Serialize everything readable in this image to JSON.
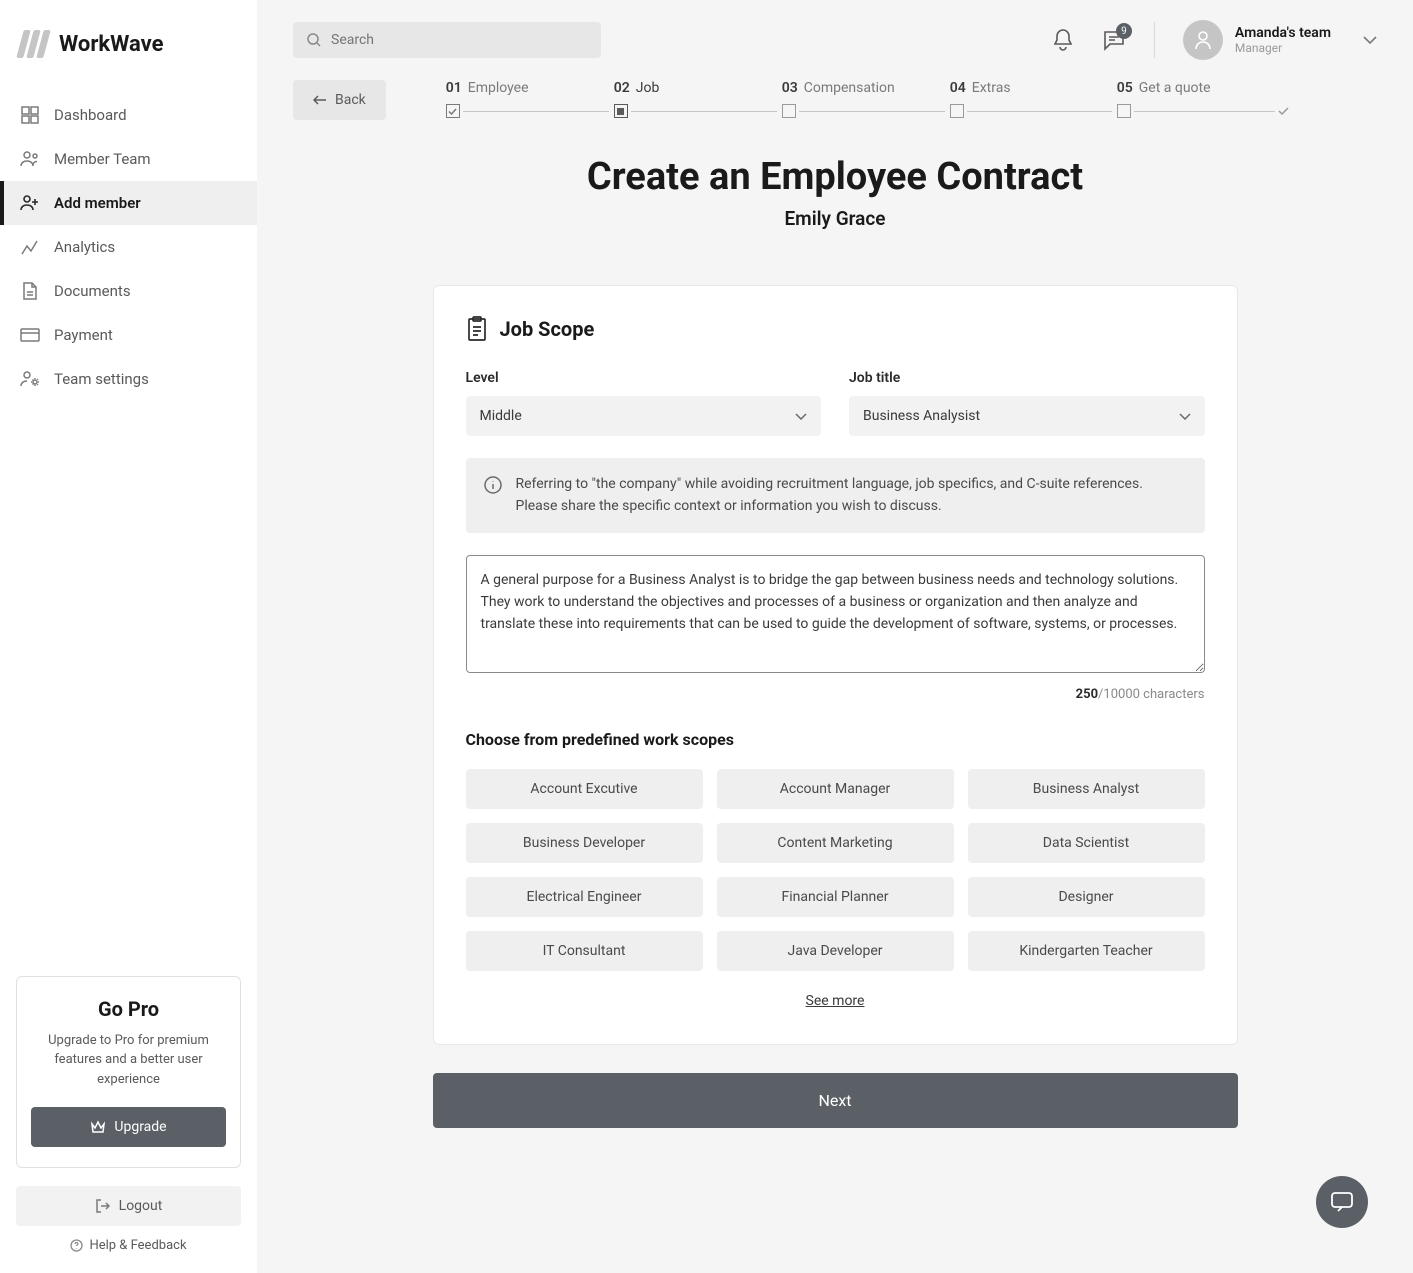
{
  "brand": "WorkWave",
  "sidebar": {
    "items": [
      {
        "label": "Dashboard"
      },
      {
        "label": "Member Team"
      },
      {
        "label": "Add member"
      },
      {
        "label": "Analytics"
      },
      {
        "label": "Documents"
      },
      {
        "label": "Payment"
      },
      {
        "label": "Team settings"
      }
    ]
  },
  "go_pro": {
    "title": "Go Pro",
    "desc": "Upgrade to Pro for premium features and a better user experience",
    "button": "Upgrade"
  },
  "footer": {
    "logout": "Logout",
    "help": "Help & Feedback"
  },
  "search": {
    "placeholder": "Search"
  },
  "notifications": {
    "badge": "9"
  },
  "user": {
    "team": "Amanda's team",
    "role": "Manager"
  },
  "back": "Back",
  "steps": [
    {
      "num": "01",
      "label": "Employee"
    },
    {
      "num": "02",
      "label": "Job"
    },
    {
      "num": "03",
      "label": "Compensation"
    },
    {
      "num": "04",
      "label": "Extras"
    },
    {
      "num": "05",
      "label": "Get a quote"
    }
  ],
  "page": {
    "title": "Create an Employee Contract",
    "subtitle": "Emily Grace"
  },
  "job_scope": {
    "heading": "Job Scope",
    "level_label": "Level",
    "level_value": "Middle",
    "title_label": "Job title",
    "title_value": "Business Analysist",
    "info": "Referring to \"the company\" while avoiding recruitment language, job specifics, and C-suite references. Please share the specific context or information you wish to discuss.",
    "textarea_value": "A general purpose for a Business Analyst is to bridge the gap between business needs and technology solutions. They work to understand the objectives and processes of a business or organization and then analyze and translate these into requirements that can be used to guide the development of software, systems, or processes.",
    "char_used": "250",
    "char_max": "/10000 characters"
  },
  "scopes": {
    "heading": "Choose from predefined work scopes",
    "items": [
      "Account Excutive",
      "Account Manager",
      "Business Analyst",
      "Business Developer",
      "Content Marketing",
      "Data Scientist",
      "Electrical Engineer",
      "Financial Planner",
      "Designer",
      "IT Consultant",
      "Java Developer",
      "Kindergarten Teacher"
    ],
    "see_more": "See more"
  },
  "next": "Next"
}
